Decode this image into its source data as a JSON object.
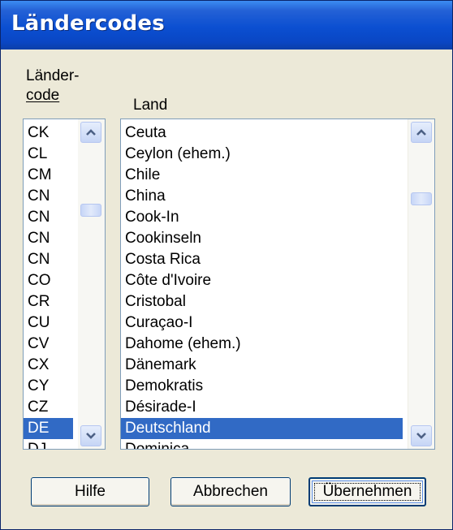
{
  "window": {
    "title": "Ländercodes"
  },
  "labels": {
    "code_line1": "Länder-",
    "code_line2": "code",
    "land": "Land"
  },
  "code_list": {
    "items": [
      "CK",
      "CL",
      "CM",
      "CN",
      "CN",
      "CN",
      "CN",
      "CO",
      "CR",
      "CU",
      "CV",
      "CX",
      "CY",
      "CZ",
      "DE",
      "DJ"
    ],
    "selected_index": 14
  },
  "land_list": {
    "items": [
      "Ceuta",
      "Ceylon (ehem.)",
      "Chile",
      "China",
      "Cook-In",
      "Cookinseln",
      "Costa Rica",
      "Côte d'Ivoire",
      "Cristobal",
      "Curaçao-I",
      "Dahome (ehem.)",
      "Dänemark",
      "Demokratis",
      "Désirade-I",
      "Deutschland",
      "Dominica"
    ],
    "selected_index": 14
  },
  "buttons": {
    "help": "Hilfe",
    "cancel": "Abbrechen",
    "apply": "Übernehmen"
  },
  "icons": {
    "scroll_up": "chevron-up-icon",
    "scroll_down": "chevron-down-icon"
  },
  "colors": {
    "title_bar": "#0a46c4",
    "selection": "#316ac5",
    "dialog_bg": "#ece9d8"
  }
}
